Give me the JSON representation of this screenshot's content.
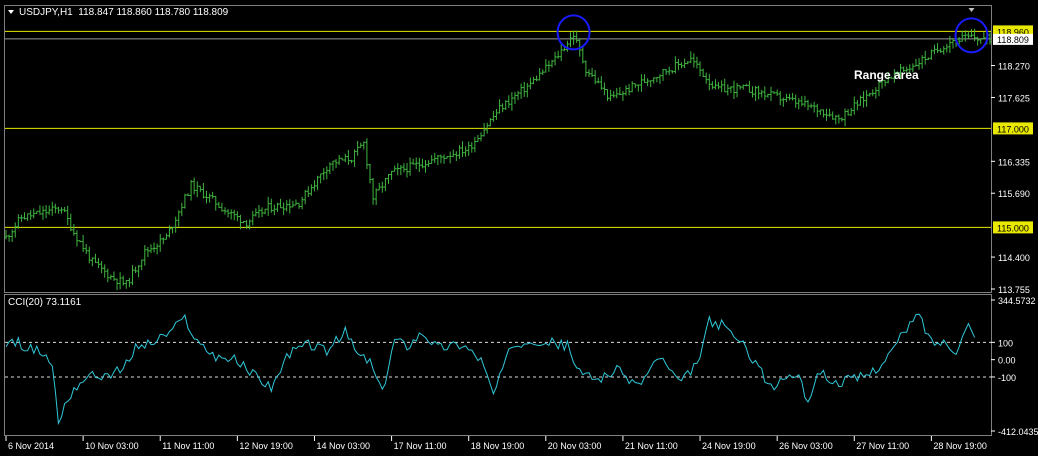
{
  "main_chart": {
    "symbol_line": "USDJPY,H1  118.847 118.860 118.780 118.809",
    "annotation": "Range area",
    "ylim": [
      113.755,
      119.15
    ],
    "y_ticks": [
      "118.270",
      "117.625",
      "116.335",
      "115.690",
      "114.400",
      "113.755"
    ],
    "levels": [
      {
        "value": 118.96,
        "label": "118.960"
      },
      {
        "value": 117.0,
        "label": "117.000"
      },
      {
        "value": 115.0,
        "label": "115.000"
      }
    ],
    "current_price": {
      "value": 118.809,
      "label": "118.809"
    },
    "circled_peaks": [
      {
        "bar": 184,
        "value": 118.9
      },
      {
        "bar": 313,
        "value": 118.84
      }
    ]
  },
  "indicator": {
    "title": "CCI(20) 73.1161",
    "ylim": [
      -412.0435,
      344.5732
    ],
    "y_ticks": [
      "344.5732",
      "100",
      "0.00",
      "-100",
      "-412.0435"
    ],
    "dashed_levels": [
      100,
      -100
    ]
  },
  "x_axis": {
    "labels": [
      "6 Nov 2014",
      "10 Nov 03:00",
      "11 Nov 11:00",
      "12 Nov 19:00",
      "14 Nov 03:00",
      "17 Nov 11:00",
      "18 Nov 19:00",
      "20 Nov 03:00",
      "21 Nov 11:00",
      "24 Nov 19:00",
      "26 Nov 03:00",
      "27 Nov 11:00",
      "28 Nov 19:00"
    ],
    "bar_count": 320
  },
  "chart_data": [
    {
      "type": "bar",
      "title": "USDJPY,H1  118.847 118.860 118.780 118.809",
      "style": "ohlc-bars",
      "ylim": [
        113.755,
        119.15
      ],
      "x_labels": [
        "6 Nov 2014",
        "10 Nov 03:00",
        "11 Nov 11:00",
        "12 Nov 19:00",
        "14 Nov 03:00",
        "17 Nov 11:00",
        "18 Nov 19:00",
        "20 Nov 03:00",
        "21 Nov 11:00",
        "24 Nov 19:00",
        "26 Nov 03:00",
        "27 Nov 11:00",
        "28 Nov 19:00"
      ],
      "x_label_bars": [
        0,
        25,
        50,
        75,
        100,
        125,
        150,
        175,
        200,
        225,
        250,
        275,
        300
      ],
      "bar_count": 320,
      "anchors": [
        [
          0,
          114.8
        ],
        [
          5,
          115.2
        ],
        [
          12,
          115.3
        ],
        [
          18,
          115.4
        ],
        [
          22,
          114.9
        ],
        [
          28,
          114.3
        ],
        [
          34,
          114.0
        ],
        [
          39,
          113.85
        ],
        [
          45,
          114.5
        ],
        [
          52,
          114.8
        ],
        [
          60,
          115.85
        ],
        [
          66,
          115.6
        ],
        [
          72,
          115.3
        ],
        [
          78,
          115.1
        ],
        [
          85,
          115.4
        ],
        [
          95,
          115.5
        ],
        [
          105,
          116.3
        ],
        [
          112,
          116.4
        ],
        [
          116,
          116.7
        ],
        [
          119,
          115.6
        ],
        [
          125,
          116.1
        ],
        [
          135,
          116.3
        ],
        [
          150,
          116.6
        ],
        [
          160,
          117.4
        ],
        [
          170,
          117.9
        ],
        [
          178,
          118.4
        ],
        [
          184,
          118.9
        ],
        [
          188,
          118.2
        ],
        [
          196,
          117.6
        ],
        [
          205,
          117.9
        ],
        [
          215,
          118.2
        ],
        [
          222,
          118.4
        ],
        [
          230,
          117.8
        ],
        [
          240,
          117.8
        ],
        [
          255,
          117.55
        ],
        [
          265,
          117.35
        ],
        [
          270,
          117.2
        ],
        [
          278,
          117.6
        ],
        [
          285,
          118.0
        ],
        [
          292,
          118.2
        ],
        [
          300,
          118.5
        ],
        [
          307,
          118.8
        ],
        [
          313,
          118.84
        ],
        [
          318,
          118.81
        ]
      ],
      "levels": [
        118.96,
        117.0,
        115.0
      ],
      "current": 118.809
    },
    {
      "type": "line",
      "title": "CCI(20) 73.1161",
      "ylim": [
        -412.0435,
        344.5732
      ],
      "dashed_levels": [
        100,
        -100
      ],
      "bar_count": 320,
      "anchors": [
        [
          0,
          80
        ],
        [
          4,
          100
        ],
        [
          8,
          60
        ],
        [
          12,
          40
        ],
        [
          15,
          -30
        ],
        [
          17,
          -370
        ],
        [
          19,
          -260
        ],
        [
          22,
          -170
        ],
        [
          26,
          -100
        ],
        [
          32,
          -90
        ],
        [
          38,
          -60
        ],
        [
          42,
          70
        ],
        [
          48,
          100
        ],
        [
          54,
          170
        ],
        [
          58,
          240
        ],
        [
          62,
          100
        ],
        [
          68,
          20
        ],
        [
          74,
          0
        ],
        [
          80,
          -80
        ],
        [
          86,
          -160
        ],
        [
          92,
          40
        ],
        [
          98,
          90
        ],
        [
          104,
          50
        ],
        [
          110,
          160
        ],
        [
          114,
          30
        ],
        [
          118,
          -10
        ],
        [
          122,
          -200
        ],
        [
          126,
          120
        ],
        [
          130,
          80
        ],
        [
          135,
          160
        ],
        [
          140,
          70
        ],
        [
          148,
          90
        ],
        [
          154,
          0
        ],
        [
          158,
          -200
        ],
        [
          164,
          80
        ],
        [
          170,
          120
        ],
        [
          176,
          100
        ],
        [
          182,
          80
        ],
        [
          186,
          -80
        ],
        [
          192,
          -110
        ],
        [
          198,
          -60
        ],
        [
          205,
          -150
        ],
        [
          212,
          20
        ],
        [
          218,
          -140
        ],
        [
          224,
          -30
        ],
        [
          228,
          220
        ],
        [
          232,
          200
        ],
        [
          236,
          140
        ],
        [
          240,
          60
        ],
        [
          244,
          -40
        ],
        [
          248,
          -170
        ],
        [
          252,
          -110
        ],
        [
          256,
          -80
        ],
        [
          260,
          -230
        ],
        [
          264,
          -60
        ],
        [
          268,
          -140
        ],
        [
          272,
          -120
        ],
        [
          276,
          -110
        ],
        [
          280,
          -80
        ],
        [
          284,
          -20
        ],
        [
          288,
          70
        ],
        [
          292,
          180
        ],
        [
          296,
          260
        ],
        [
          300,
          100
        ],
        [
          304,
          100
        ],
        [
          308,
          60
        ],
        [
          312,
          200
        ],
        [
          316,
          50
        ],
        [
          320,
          73
        ]
      ]
    }
  ]
}
